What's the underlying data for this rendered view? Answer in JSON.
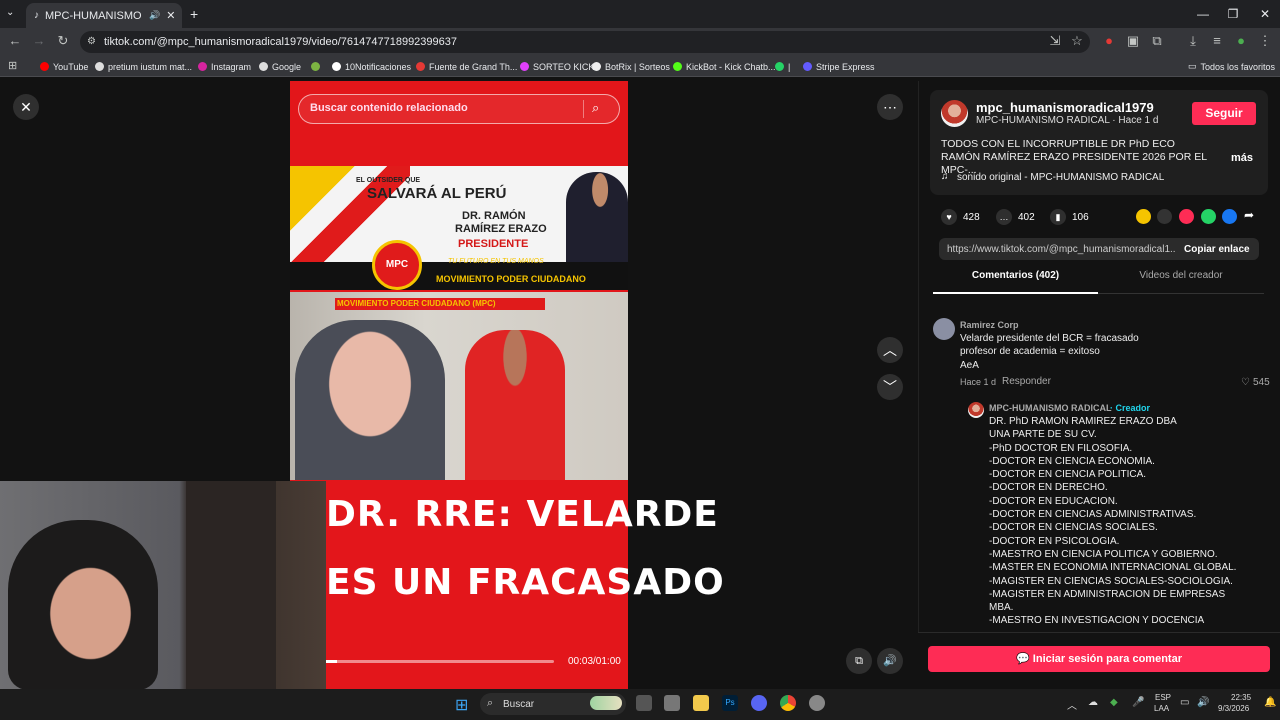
{
  "browser": {
    "tab_title": "MPC-HUMANISMO RADICA",
    "url": "tiktok.com/@mpc_humanismoradical1979/video/7614747718992399637",
    "bookmarks": [
      "YouTube",
      "pretium iustum mat...",
      "Instagram",
      "Google",
      "10Notificaciones",
      "Fuente de Grand Th...",
      "SORTEO KICK",
      "BotRix | Sorteos",
      "KickBot - Kick Chatb...",
      "|",
      "Stripe Express"
    ],
    "all_bookmarks": "Todos los favoritos"
  },
  "video": {
    "search_placeholder": "Buscar contenido relacionado",
    "banner_line1": "EL OUTSIDER QUE",
    "banner_line2": "SALVARÁ AL PERÚ",
    "banner_name1": "DR. RAMÓN",
    "banner_name2": "RAMÍREZ ERAZO",
    "banner_role": "PRESIDENTE",
    "banner_slogan": "TU FUTURO EN TUS MANOS",
    "banner_movement": "MOVIMIENTO PODER CIUDADANO",
    "logo_text": "MPC",
    "photo_header": "MOVIMIENTO PODER CIUDADANO (MPC)",
    "caption_line1": "DR. RRE: VELARDE",
    "caption_line2": "ES UN FRACASADO",
    "time": "00:03/01:00",
    "progress": 0.05
  },
  "creator": {
    "username": "mpc_humanismoradical1979",
    "subtitle": "MPC-HUMANISMO RADICAL · Hace 1 d",
    "follow": "Seguir",
    "description": "TODOS CON EL INCORRUPTIBLE DR PhD ECO RAMÓN RAMÍREZ ERAZO PRESIDENTE 2026 POR EL MPC-...",
    "more": "más",
    "sound": "sonido original - MPC-HUMANISMO RADICAL"
  },
  "stats": {
    "likes": "428",
    "comments": "402",
    "saves": "106"
  },
  "link": {
    "url": "https://www.tiktok.com/@mpc_humanismoradical1...",
    "copy": "Copiar enlace"
  },
  "tabs": {
    "comments": "Comentarios (402)",
    "videos": "Videos del creador"
  },
  "comments": [
    {
      "author": "Ramirez Corp",
      "text": "Velarde presidente del BCR = fracasado\nprofesor de academia = exitoso\nAeA",
      "meta": "Hace 1 d",
      "reply": "Responder",
      "likes": "545"
    },
    {
      "author": "MPC-HUMANISMO RADICAL",
      "badge": "· Creador",
      "text": "DR. PhD RAMON RAMIREZ ERAZO DBA\nUNA PARTE DE SU CV.\n-PhD DOCTOR EN FILOSOFIA.\n-DOCTOR EN CIENCIA ECONOMIA.\n-DOCTOR EN CIENCIA POLITICA.\n-DOCTOR EN DERECHO.\n-DOCTOR EN EDUCACION.\n-DOCTOR EN CIENCIAS ADMINISTRATIVAS.\n-DOCTOR EN CIENCIAS SOCIALES.\n-DOCTOR EN PSICOLOGIA.\n-MAESTRO EN CIENCIA POLITICA Y GOBIERNO.\n-MASTER EN ECONOMIA INTERNACIONAL GLOBAL.\n-MAGISTER EN CIENCIAS SOCIALES-SOCIOLOGIA.\n-MAGISTER EN ADMINISTRACION DE EMPRESAS\nMBA.\n-MAESTRO EN INVESTIGACION Y DOCENCIA"
    }
  ],
  "login": "Iniciar sesión para comentar",
  "taskbar": {
    "search": "Buscar",
    "lang1": "ESP",
    "lang2": "LAA",
    "time": "22:35",
    "date": "9/3/2026"
  },
  "colors": {
    "tiktok_pink": "#fe2c55",
    "video_red": "#e2161a",
    "creator_badge": "#20d5ec"
  }
}
